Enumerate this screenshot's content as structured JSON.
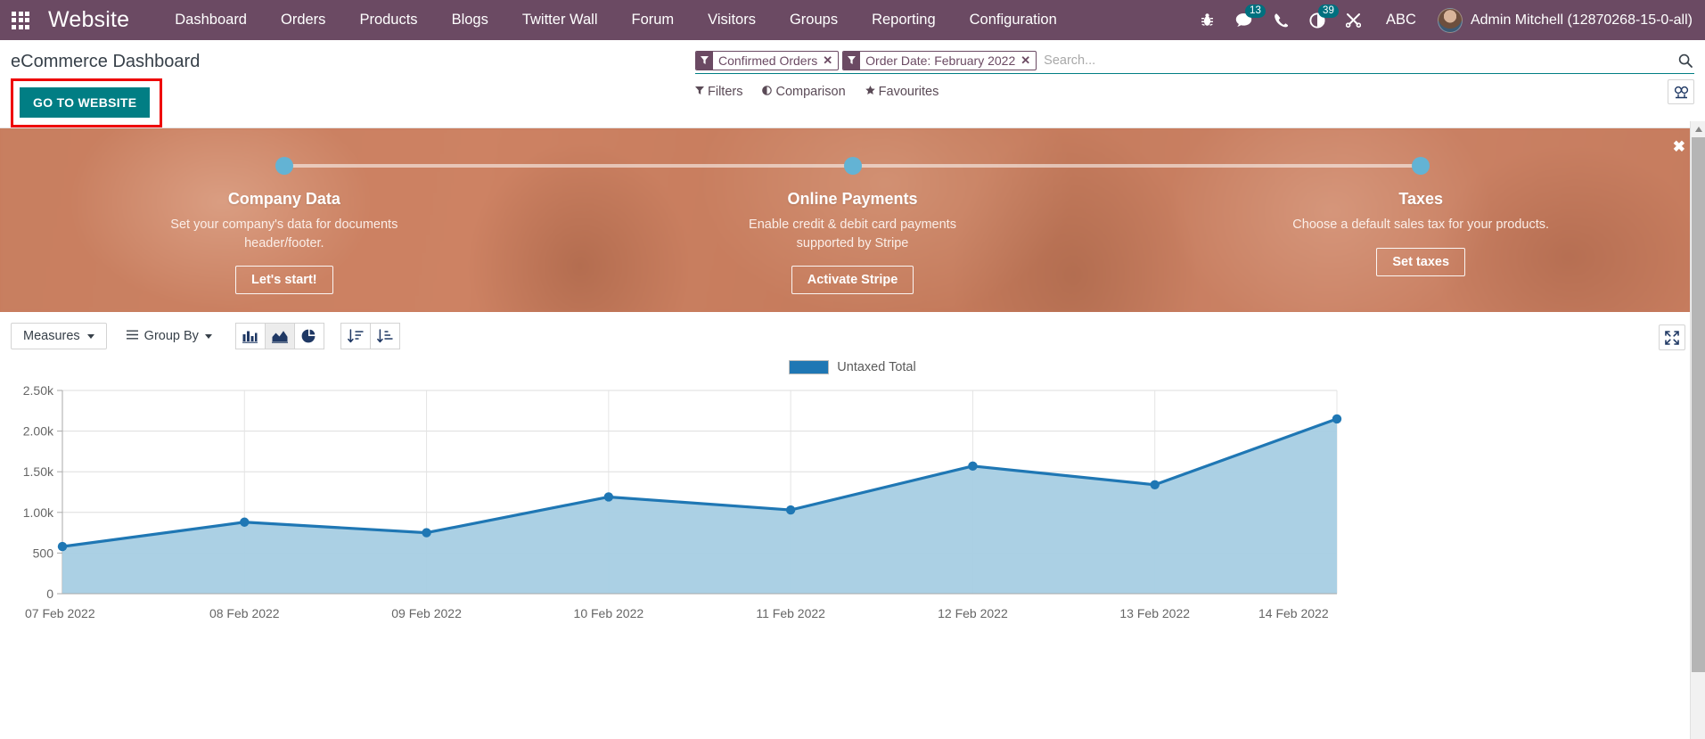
{
  "navbar": {
    "apps_icon": "apps-grid-icon",
    "brand": "Website",
    "menu": [
      {
        "label": "Dashboard"
      },
      {
        "label": "Orders"
      },
      {
        "label": "Products"
      },
      {
        "label": "Blogs"
      },
      {
        "label": "Twitter Wall"
      },
      {
        "label": "Forum"
      },
      {
        "label": "Visitors"
      },
      {
        "label": "Groups"
      },
      {
        "label": "Reporting"
      },
      {
        "label": "Configuration"
      }
    ],
    "systray": [
      {
        "name": "bug-icon",
        "glyph": "☣",
        "badge": null
      },
      {
        "name": "messages-icon",
        "glyph": "💬",
        "badge": "13"
      },
      {
        "name": "phone-icon",
        "glyph": "☎",
        "badge": null
      },
      {
        "name": "activities-clock-icon",
        "glyph": "◔",
        "badge": "39"
      },
      {
        "name": "tools-icon",
        "glyph": "✂",
        "badge": null
      }
    ],
    "abc_label": "ABC",
    "user_name": "Admin Mitchell (12870268-15-0-all)"
  },
  "control_panel": {
    "page_title": "eCommerce Dashboard",
    "go_to_website_label": "GO TO WEBSITE",
    "highlight_color": "#ee0000",
    "button_color": "#017e84",
    "facets": [
      {
        "label": "Confirmed Orders",
        "icon": "filter-icon",
        "remove": "✕"
      },
      {
        "label": "Order Date: February 2022",
        "icon": "filter-icon",
        "remove": "✕"
      }
    ],
    "search_placeholder": "Search...",
    "search_value": "",
    "tools": [
      {
        "label": "Filters",
        "icon": "filter-caret-icon",
        "glyph": "▼"
      },
      {
        "label": "Comparison",
        "icon": "comparison-icon",
        "glyph": "◑"
      },
      {
        "label": "Favourites",
        "icon": "star-icon",
        "glyph": "★"
      }
    ],
    "view_switch_icon": "graph-view-icon"
  },
  "banner": {
    "close_glyph": "✖",
    "steps": [
      {
        "title": "Company Data",
        "desc": "Set your company's data for documents header/footer.",
        "button": "Let's start!",
        "dot_color": "#63b3d4"
      },
      {
        "title": "Online Payments",
        "desc": "Enable credit & debit card payments supported by Stripe",
        "button": "Activate Stripe",
        "dot_color": "#63b3d4"
      },
      {
        "title": "Taxes",
        "desc": "Choose a default sales tax for your products.",
        "button": "Set taxes",
        "dot_color": "#63b3d4"
      }
    ]
  },
  "graph": {
    "measures_label": "Measures",
    "group_by_label": "Group By",
    "chart_type_buttons": [
      {
        "name": "bar-chart-icon",
        "active": false
      },
      {
        "name": "line-area-chart-icon",
        "active": true
      },
      {
        "name": "pie-chart-icon",
        "active": false
      }
    ],
    "sort_buttons": [
      {
        "name": "sort-descending-icon"
      },
      {
        "name": "sort-ascending-icon"
      }
    ],
    "expand_icon": "expand-fullscreen-icon"
  },
  "chart_data": {
    "type": "area",
    "title": "",
    "xlabel": "",
    "ylabel": "",
    "legend": [
      {
        "name": "Untaxed Total",
        "color": "#1f77b4"
      }
    ],
    "legend_position": "top-center",
    "grid": true,
    "categories": [
      "07 Feb 2022",
      "08 Feb 2022",
      "09 Feb 2022",
      "10 Feb 2022",
      "11 Feb 2022",
      "12 Feb 2022",
      "13 Feb 2022",
      "14 Feb 2022"
    ],
    "series": [
      {
        "name": "Untaxed Total",
        "color": "#1f77b4",
        "fill": "#a6cee3",
        "values": [
          580,
          880,
          750,
          1190,
          1030,
          1570,
          1340,
          2150
        ]
      }
    ],
    "ylim": [
      0,
      2500
    ],
    "ytick_labels": [
      "0",
      "500",
      "1.00k",
      "1.50k",
      "2.00k",
      "2.50k"
    ],
    "ytick_values": [
      0,
      500,
      1000,
      1500,
      2000,
      2500
    ]
  },
  "scrollbar": {
    "up_arrow": "scroll-up-arrow"
  }
}
